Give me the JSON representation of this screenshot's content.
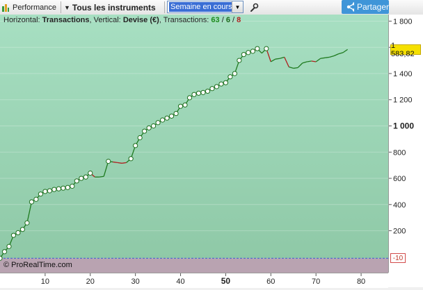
{
  "toolbar": {
    "performance_label": "Performance",
    "instruments_label": "Tous les instruments",
    "period_value": "Semaine en cours",
    "share_label": "Partager",
    "icons": [
      "bar-chart-icon",
      "chevron-down-icon",
      "wrench-icon",
      "share-icon"
    ]
  },
  "chart": {
    "info_prefix": "Horizontal:",
    "horizontal_value": "Transactions",
    "vertical_prefix": ", Vertical:",
    "vertical_value": "Devise (€)",
    "transactions_prefix": ", Transactions:",
    "transactions_total": "63",
    "slash1": " / ",
    "transactions_win": "6",
    "slash2": " / ",
    "transactions_loss": "8",
    "last_value_label": "1 583,82",
    "negative_label": "-10",
    "credit": "© ProRealTime.com",
    "colors": {
      "zone_top": "#a7dfc2",
      "zone_bottom": "#8fc9a7",
      "negative_zone": "#b9a3b1",
      "line_up": "#1e7a1e",
      "line_down": "#b01c1c"
    }
  },
  "chart_data": {
    "type": "line",
    "xlabel": "",
    "ylabel": "",
    "xlim": [
      0,
      86
    ],
    "ylim": [
      -120,
      1850
    ],
    "x_ticks": [
      10,
      20,
      30,
      40,
      50,
      60,
      70,
      80
    ],
    "x_tick_bold": 50,
    "y_ticks": [
      200,
      400,
      600,
      800,
      1000,
      1200,
      1400,
      1600,
      1800
    ],
    "y_tick_bold": 1000,
    "baseline": -10,
    "x": [
      0,
      1,
      2,
      3,
      4,
      5,
      6,
      7,
      8,
      9,
      10,
      11,
      12,
      13,
      14,
      15,
      16,
      17,
      18,
      19,
      20,
      21,
      22,
      23,
      24,
      25,
      26,
      27,
      28,
      29,
      30,
      31,
      32,
      33,
      34,
      35,
      36,
      37,
      38,
      39,
      40,
      41,
      42,
      43,
      44,
      45,
      46,
      47,
      48,
      49,
      50,
      51,
      52,
      53,
      54,
      55,
      56,
      57,
      58,
      59,
      60,
      61,
      62,
      63,
      64,
      65,
      66,
      67,
      68,
      69,
      70,
      71,
      72,
      73,
      74,
      75,
      76,
      77
    ],
    "y": [
      -10,
      40,
      80,
      165,
      185,
      210,
      260,
      420,
      440,
      480,
      500,
      505,
      515,
      520,
      525,
      530,
      540,
      580,
      600,
      610,
      640,
      610,
      610,
      615,
      730,
      725,
      720,
      715,
      720,
      750,
      850,
      910,
      960,
      985,
      1000,
      1025,
      1045,
      1060,
      1075,
      1095,
      1150,
      1160,
      1215,
      1240,
      1250,
      1255,
      1265,
      1285,
      1300,
      1320,
      1330,
      1375,
      1400,
      1500,
      1545,
      1560,
      1570,
      1590,
      1555,
      1590,
      1490,
      1510,
      1515,
      1525,
      1450,
      1440,
      1445,
      1480,
      1490,
      1495,
      1490,
      1515,
      1520,
      1525,
      1535,
      1550,
      1560,
      1584
    ],
    "markers": [
      0,
      1,
      2,
      3,
      4,
      5,
      6,
      7,
      8,
      9,
      10,
      11,
      12,
      13,
      14,
      15,
      16,
      17,
      18,
      19,
      20,
      24,
      29,
      30,
      31,
      32,
      33,
      34,
      35,
      36,
      37,
      38,
      39,
      40,
      41,
      42,
      43,
      44,
      45,
      46,
      47,
      48,
      49,
      50,
      51,
      52,
      53,
      54,
      55,
      56,
      57,
      59
    ],
    "down_segments": [
      [
        20,
        21
      ],
      [
        25,
        28
      ],
      [
        56,
        57
      ],
      [
        59,
        60
      ],
      [
        63,
        64
      ],
      [
        69,
        70
      ]
    ],
    "last_value": 1583.82
  }
}
